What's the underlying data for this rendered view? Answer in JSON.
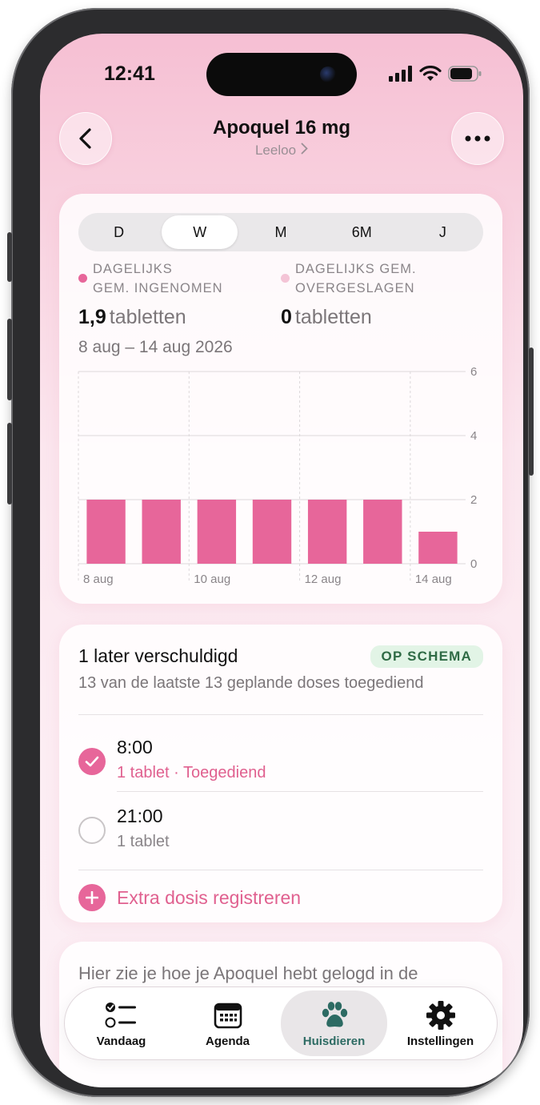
{
  "status_bar": {
    "time": "12:41"
  },
  "header": {
    "title": "Apoquel 16 mg",
    "subtitle": "Leeloo"
  },
  "segments": {
    "items": [
      "D",
      "W",
      "M",
      "6M",
      "J"
    ],
    "selected": "W"
  },
  "stats": {
    "taken": {
      "label_line1": "DAGELIJKS",
      "label_line2": "GEM. INGENOMEN",
      "value": "1,9",
      "unit": "tabletten",
      "color": "#e7669a"
    },
    "skipped": {
      "label_line1": "DAGELIJKS GEM.",
      "label_line2": "OVERGESLAGEN",
      "value": "0",
      "unit": "tabletten",
      "color": "#f4c4d6"
    }
  },
  "date_range": "8 aug – 14 aug 2026",
  "chart_data": {
    "type": "bar",
    "categories": [
      "8 aug",
      "9 aug",
      "10 aug",
      "11 aug",
      "12 aug",
      "13 aug",
      "14 aug"
    ],
    "values": [
      2,
      2,
      2,
      2,
      2,
      2,
      1
    ],
    "x_tick_labels": [
      "8 aug",
      "10 aug",
      "12 aug",
      "14 aug"
    ],
    "y_ticks": [
      0,
      2,
      4,
      6
    ],
    "ylim": [
      0,
      6
    ],
    "bar_color": "#e7669a",
    "grid": true
  },
  "schedule": {
    "title": "1 later verschuldigd",
    "badge": "OP SCHEMA",
    "subtitle": "13 van de laatste 13 geplande doses toegediend",
    "doses": [
      {
        "time": "8:00",
        "detail": "1 tablet · Toegediend",
        "done": true
      },
      {
        "time": "21:00",
        "detail": "1 tablet",
        "done": false
      }
    ],
    "extra_label": "Extra dosis registreren"
  },
  "info": {
    "text": "Hier zie je hoe je Apoquel hebt gelogd in de"
  },
  "tabbar": {
    "items": [
      {
        "label": "Vandaag",
        "icon": "checklist-icon"
      },
      {
        "label": "Agenda",
        "icon": "calendar-icon"
      },
      {
        "label": "Huisdieren",
        "icon": "paw-icon"
      },
      {
        "label": "Instellingen",
        "icon": "gear-icon"
      }
    ],
    "selected": "Huisdieren"
  }
}
